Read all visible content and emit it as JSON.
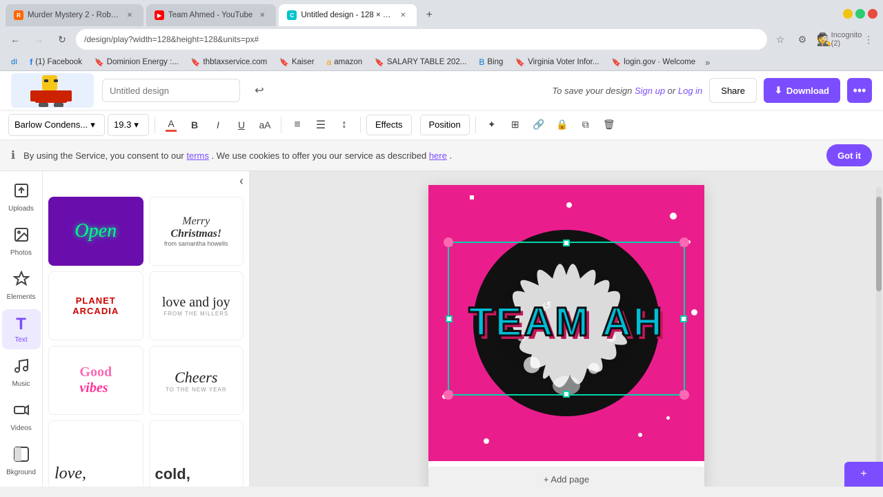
{
  "browser": {
    "tabs": [
      {
        "id": "tab-roblox",
        "label": "Murder Mystery 2 - Roblox",
        "favicon_color": "#ff6600",
        "active": false
      },
      {
        "id": "tab-youtube",
        "label": "Team Ahmed - YouTube",
        "favicon_color": "#ff0000",
        "active": false
      },
      {
        "id": "tab-canva",
        "label": "Untitled design - 128 × 128px",
        "favicon_color": "#00c4cc",
        "active": true
      }
    ],
    "url": "/design/play?width=128&height=128&units=px#",
    "bookmarks": [
      {
        "label": "dI",
        "color": "#0077cc"
      },
      {
        "label": "(1) Facebook",
        "favicon": "f",
        "color": "#1877f2"
      },
      {
        "label": "Dominion Energy :...",
        "color": "#004080"
      },
      {
        "label": "thbtaxservice.com",
        "color": "#333"
      },
      {
        "label": "Kaiser",
        "color": "#005a8e"
      },
      {
        "label": "amazon",
        "color": "#ff9900"
      },
      {
        "label": "SALARY TABLE 202...",
        "color": "#333"
      },
      {
        "label": "Bing",
        "color": "#0078d4"
      },
      {
        "label": "Virginia Voter Infor...",
        "color": "#333"
      },
      {
        "label": "login.gov · Welcome",
        "color": "#333"
      }
    ]
  },
  "app": {
    "title": "Untitled design",
    "save_prompt": "To save your design Sign up or Log in",
    "share_label": "Share",
    "download_label": "Download",
    "more_label": "•••",
    "undo_icon": "↩"
  },
  "format_bar": {
    "font": "Barlow Condens...",
    "font_size": "19.3",
    "color_label": "Text color",
    "bold": "B",
    "italic": "I",
    "underline": "U",
    "case": "aA",
    "align": "≡",
    "list": "☰",
    "spacing": "↕",
    "effects_label": "Effects",
    "position_label": "Position"
  },
  "cookie": {
    "message": "By using the Service, you consent to our",
    "terms_label": "terms",
    "mid_text": ". We use cookies to offer you our service as described",
    "here_label": "here",
    "end_text": ".",
    "got_it": "Got it"
  },
  "sidebar": {
    "items": [
      {
        "id": "uploads",
        "label": "Uploads",
        "icon": "⬆"
      },
      {
        "id": "photos",
        "label": "Photos",
        "icon": "🖼"
      },
      {
        "id": "elements",
        "label": "Elements",
        "icon": "✦"
      },
      {
        "id": "text",
        "label": "Text",
        "icon": "T"
      },
      {
        "id": "music",
        "label": "Music",
        "icon": "♪"
      },
      {
        "id": "videos",
        "label": "Videos",
        "icon": "▶"
      },
      {
        "id": "bkground",
        "label": "Bkground",
        "icon": "◧"
      }
    ]
  },
  "canvas": {
    "background_color": "#e91e8c",
    "main_text": "TEAM AH",
    "add_page_label": "+ Add page"
  },
  "templates": [
    {
      "id": "open",
      "bg": "#6a0dad",
      "text": "Open",
      "text_color": "#00ff00"
    },
    {
      "id": "merry-christmas",
      "bg": "#fff",
      "text": "Merry Christmas! from samantha howells",
      "text_color": "#333"
    },
    {
      "id": "planet-arcadia",
      "bg": "#fff",
      "text": "PLANET ARCADIA",
      "text_color": "#cc0000"
    },
    {
      "id": "love-and-joy",
      "bg": "#fff",
      "text": "love and joy FROM THE MILLERS",
      "text_color": "#222"
    },
    {
      "id": "good-vibes",
      "bg": "#fff",
      "text": "Good vibes",
      "text_color": "#ff69b4"
    },
    {
      "id": "cheers",
      "bg": "#fff",
      "text": "Cheers TO THE NEW YEAR",
      "text_color": "#222"
    },
    {
      "id": "love2",
      "bg": "#fff",
      "text": "love,",
      "text_color": "#222"
    },
    {
      "id": "cold",
      "bg": "#fff",
      "text": "cold,",
      "text_color": "#333"
    }
  ]
}
